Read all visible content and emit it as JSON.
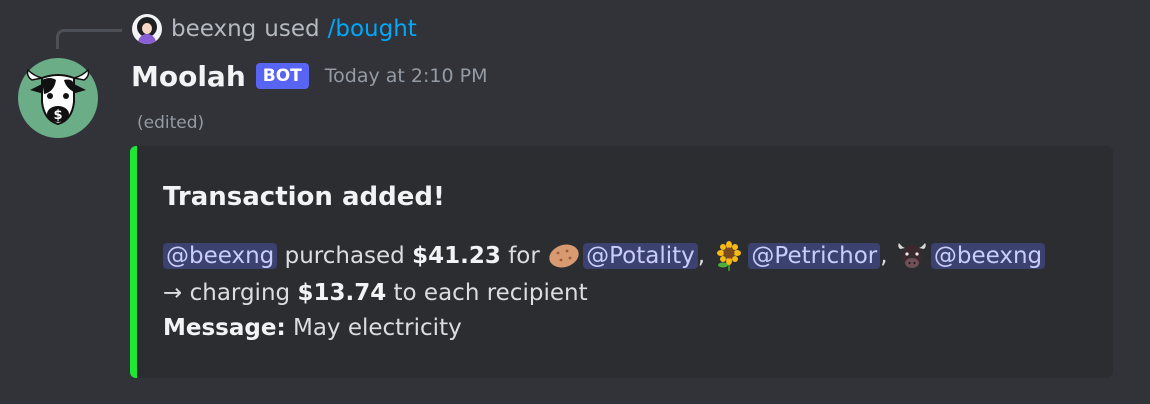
{
  "reply": {
    "user": "beexng",
    "used": "used",
    "command": "/bought"
  },
  "message": {
    "author": "Moolah",
    "bot_tag": "BOT",
    "timestamp": "Today at 2:10 PM",
    "edited": "(edited)"
  },
  "embed": {
    "accent_color": "#1de834",
    "title": "Transaction added!",
    "buyer_mention": "@beexng",
    "purchased": "purchased",
    "amount": "$41.23",
    "for": "for",
    "recipients": [
      {
        "emoji": "potato",
        "mention": "@Potality"
      },
      {
        "emoji": "sunflower",
        "mention": "@Petrichor"
      },
      {
        "emoji": "cow",
        "mention": "@beexng"
      }
    ],
    "separator": ",",
    "arrow": "→",
    "charging": "charging",
    "each_amount": "$13.74",
    "each_suffix": "to each recipient",
    "message_label": "Message:",
    "message_text": "May electricity"
  },
  "colors": {
    "background": "#313338",
    "embed_bg": "#2b2d31",
    "bot_tag": "#5865f2",
    "mention_bg": "#3c4270",
    "command_link": "#00a8fc"
  }
}
